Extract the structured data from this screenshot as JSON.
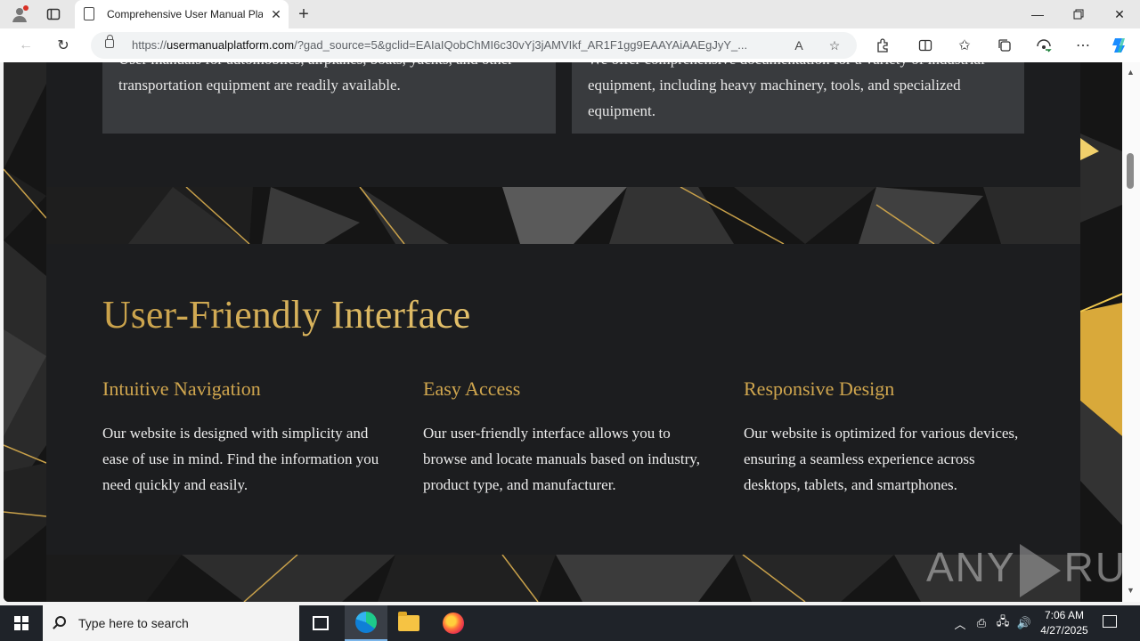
{
  "browser": {
    "tab_title": "Comprehensive User Manual Platform",
    "url_host": "usermanualplatform.com",
    "url_prefix": "https://",
    "url_rest": "/?gad_source=5&gclid=EAIaIQobChMI6c30vYj3jAMVIkf_AR1F1gg9EAAYAiAAEgJyY_..."
  },
  "page": {
    "top_cards": [
      {
        "text": "User manuals for automobiles, airplanes, boats, yachts, and other transportation equipment are readily available."
      },
      {
        "text": "We offer comprehensive documentation for a variety of industrial equipment, including heavy machinery, tools, and specialized equipment."
      }
    ],
    "section_title": "User-Friendly Interface",
    "features": [
      {
        "title": "Intuitive Navigation",
        "text": "Our website is designed with simplicity and ease of use in mind. Find the information you need quickly and easily."
      },
      {
        "title": "Easy Access",
        "text": "Our user-friendly interface allows you to browse and locate manuals based on industry, product type, and manufacturer."
      },
      {
        "title": "Responsive Design",
        "text": "Our website is optimized for various devices, ensuring a seamless experience across desktops, tablets, and smartphones."
      }
    ],
    "watermark_left": "ANY",
    "watermark_right": "RUN"
  },
  "taskbar": {
    "search_placeholder": "Type here to search",
    "time": "7:06 AM",
    "date": "4/27/2025"
  },
  "colors": {
    "accent_gold": "#c9a14a",
    "panel": "#1c1d1f",
    "card": "#393b3e"
  }
}
